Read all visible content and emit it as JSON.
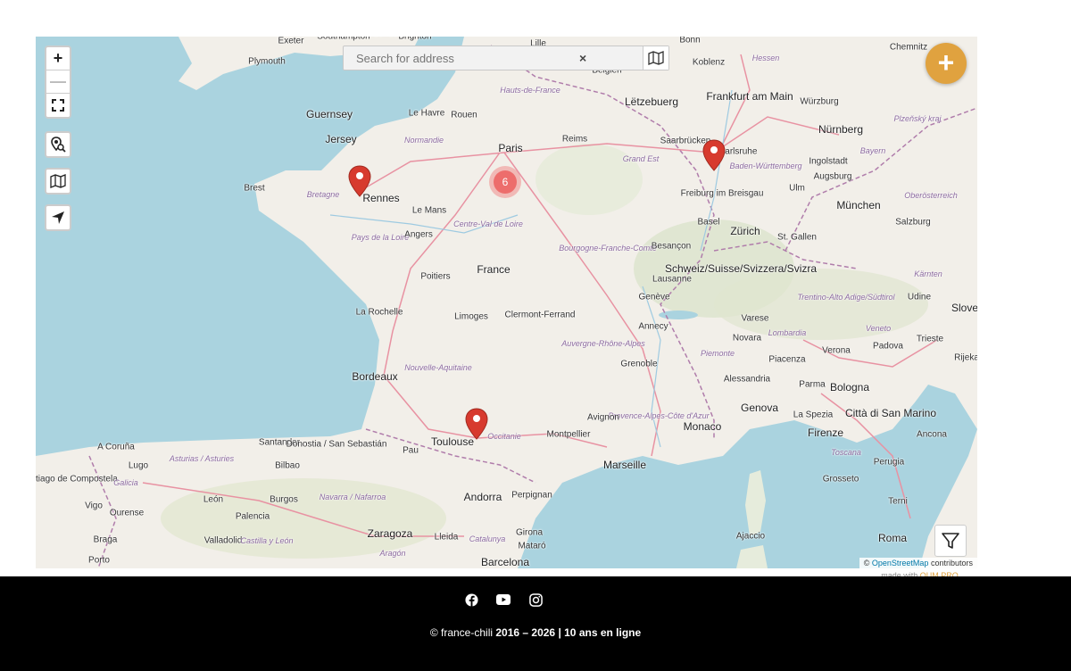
{
  "map": {
    "search": {
      "placeholder": "Search for address",
      "clear": "×"
    },
    "controls": {
      "zoom_in": "+",
      "zoom_out": "—"
    },
    "add_label": "+",
    "cluster": {
      "count": "6"
    },
    "cities": [
      {
        "name": "Exeter"
      },
      {
        "name": "Plymouth"
      },
      {
        "name": "Southampton"
      },
      {
        "name": "Brighton"
      },
      {
        "name": "Lille"
      },
      {
        "name": "London"
      },
      {
        "name": "Bonn"
      },
      {
        "name": "Koblenz"
      },
      {
        "name": "Hessen"
      },
      {
        "name": "Chemnitz"
      },
      {
        "name": "Belgien"
      },
      {
        "name": "Hauts-de-France"
      },
      {
        "name": "Lëtzebuerg"
      },
      {
        "name": "Frankfurt am Main"
      },
      {
        "name": "Würzburg"
      },
      {
        "name": "Guernsey"
      },
      {
        "name": "Le Havre"
      },
      {
        "name": "Rouen"
      },
      {
        "name": "Jersey"
      },
      {
        "name": "Normandie"
      },
      {
        "name": "Paris"
      },
      {
        "name": "Reims"
      },
      {
        "name": "Saarbrücken"
      },
      {
        "name": "Karlsruhe"
      },
      {
        "name": "Nürnberg"
      },
      {
        "name": "Bayern"
      },
      {
        "name": "Plzeňský kraj"
      },
      {
        "name": "Grand Est"
      },
      {
        "name": "Baden-Württemberg"
      },
      {
        "name": "Ingolstadt"
      },
      {
        "name": "Augsburg"
      },
      {
        "name": "Brest"
      },
      {
        "name": "Bretagne"
      },
      {
        "name": "Rennes"
      },
      {
        "name": "Le Mans"
      },
      {
        "name": "Freiburg im Breisgau"
      },
      {
        "name": "Ulm"
      },
      {
        "name": "München"
      },
      {
        "name": "Oberösterreich"
      },
      {
        "name": "Centre-Val de Loire"
      },
      {
        "name": "Pays de la Loire"
      },
      {
        "name": "Angers"
      },
      {
        "name": "Basel"
      },
      {
        "name": "Zürich"
      },
      {
        "name": "St. Gallen"
      },
      {
        "name": "Salzburg"
      },
      {
        "name": "Bourgogne-Franche-Comté"
      },
      {
        "name": "France"
      },
      {
        "name": "Besançon"
      },
      {
        "name": "Schweiz/Suisse/Svizzera/Svizra"
      },
      {
        "name": "Poitiers"
      },
      {
        "name": "Lausanne"
      },
      {
        "name": "Kärnten"
      },
      {
        "name": "Genève"
      },
      {
        "name": "Trentino-Alto Adige/Südtirol"
      },
      {
        "name": "Udine"
      },
      {
        "name": "Slove"
      },
      {
        "name": "La Rochelle"
      },
      {
        "name": "Limoges"
      },
      {
        "name": "Clermont-Ferrand"
      },
      {
        "name": "Annecy"
      },
      {
        "name": "Varese"
      },
      {
        "name": "Veneto"
      },
      {
        "name": "Novara"
      },
      {
        "name": "Lombardia"
      },
      {
        "name": "Padova"
      },
      {
        "name": "Trieste"
      },
      {
        "name": "Rijeka"
      },
      {
        "name": "Auvergne-Rhône-Alpes"
      },
      {
        "name": "Nouvelle-Aquitaine"
      },
      {
        "name": "Grenoble"
      },
      {
        "name": "Piemonte"
      },
      {
        "name": "Piacenza"
      },
      {
        "name": "Verona"
      },
      {
        "name": "Bordeaux"
      },
      {
        "name": "Alessandria"
      },
      {
        "name": "Parma"
      },
      {
        "name": "Bologna"
      },
      {
        "name": "Provence-Alpes-Côte d'Azur"
      },
      {
        "name": "Genova"
      },
      {
        "name": "La Spezia"
      },
      {
        "name": "Città di San Marino"
      },
      {
        "name": "Avignon"
      },
      {
        "name": "Monaco"
      },
      {
        "name": "Toulouse"
      },
      {
        "name": "Occitanie"
      },
      {
        "name": "Montpellier"
      },
      {
        "name": "Firenze"
      },
      {
        "name": "Ancona"
      },
      {
        "name": "A Coruña"
      },
      {
        "name": "Santander"
      },
      {
        "name": "Donostia / San Sebastián"
      },
      {
        "name": "Pau"
      },
      {
        "name": "Marseille"
      },
      {
        "name": "Toscana"
      },
      {
        "name": "Asturias / Asturies"
      },
      {
        "name": "Bilbao"
      },
      {
        "name": "Lugo"
      },
      {
        "name": "Santiago de Compostela"
      },
      {
        "name": "Galicia"
      },
      {
        "name": "Andorra"
      },
      {
        "name": "Perpignan"
      },
      {
        "name": "Perugia"
      },
      {
        "name": "Grosseto"
      },
      {
        "name": "Vigo"
      },
      {
        "name": "León"
      },
      {
        "name": "Burgos"
      },
      {
        "name": "Navarra / Nafarroa"
      },
      {
        "name": "Ourense"
      },
      {
        "name": "Palencia"
      },
      {
        "name": "Terni"
      },
      {
        "name": "Braga"
      },
      {
        "name": "Valladolid"
      },
      {
        "name": "Castilla y León"
      },
      {
        "name": "Zaragoza"
      },
      {
        "name": "Lleida"
      },
      {
        "name": "Girona"
      },
      {
        "name": "Ajaccio"
      },
      {
        "name": "Roma"
      },
      {
        "name": "Catalunya"
      },
      {
        "name": "Mataró"
      },
      {
        "name": "Aragón"
      },
      {
        "name": "Porto"
      },
      {
        "name": "Barcelona"
      }
    ],
    "attribution": {
      "prefix": "©",
      "link": "OpenStreetMap",
      "suffix": "contributors"
    },
    "made_with": {
      "prefix": "made with",
      "brand": "OUM PRO"
    },
    "colors": {
      "water": "#aad3df",
      "land": "#f2efe9",
      "marker": "#d73a2e",
      "accent": "#e0a23f"
    }
  },
  "footer": {
    "icons": [
      "facebook-icon",
      "youtube-icon",
      "instagram-icon"
    ],
    "copyright_prefix": "© france-chili",
    "copyright_bold": "2016 – 2026 | 10 ans en ligne"
  }
}
